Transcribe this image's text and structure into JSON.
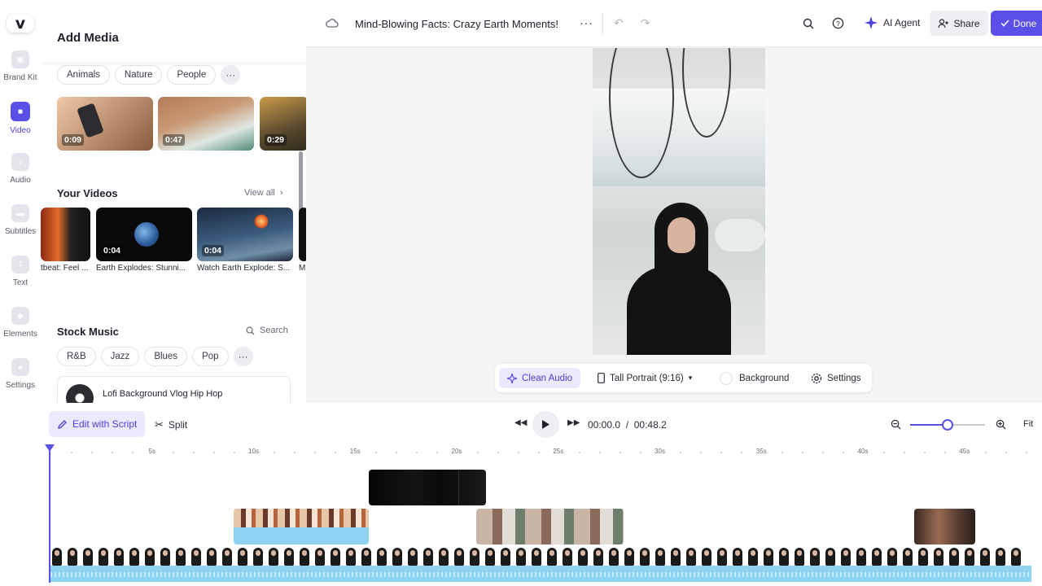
{
  "app": {
    "logo_letter": "v",
    "rail": [
      {
        "label": "Brand Kit",
        "icon": "brand-kit-icon",
        "active": false
      },
      {
        "label": "Video",
        "icon": "video-icon",
        "active": true
      },
      {
        "label": "Audio",
        "icon": "audio-icon",
        "active": false
      },
      {
        "label": "Subtitles",
        "icon": "subtitles-icon",
        "active": false
      },
      {
        "label": "Text",
        "icon": "text-icon",
        "active": false
      },
      {
        "label": "Elements",
        "icon": "elements-icon",
        "active": false
      },
      {
        "label": "Settings",
        "icon": "settings-icon",
        "active": false
      }
    ]
  },
  "panel": {
    "title": "Add Media",
    "video_chips": [
      "Animals",
      "Nature",
      "People"
    ],
    "stock_videos": [
      {
        "duration": "0:09",
        "colors": [
          "#f0c9a8",
          "#8a5a3c"
        ]
      },
      {
        "duration": "0:47",
        "colors": [
          "#b37b55",
          "#dfe8e3"
        ]
      },
      {
        "duration": "0:29",
        "colors": [
          "#5a4a2e",
          "#c99a4a"
        ]
      }
    ],
    "your_videos_title": "Your Videos",
    "view_all": "View all",
    "your_videos": [
      {
        "caption": "tbeat: Feel ...",
        "duration": ""
      },
      {
        "caption": "Earth Explodes: Stunni...",
        "duration": "0:04"
      },
      {
        "caption": "Watch Earth Explode: S...",
        "duration": "0:04"
      },
      {
        "caption": "Mi",
        "duration": ""
      }
    ],
    "stock_music_title": "Stock Music",
    "search_label": "Search",
    "music_chips": [
      "R&B",
      "Jazz",
      "Blues",
      "Pop"
    ],
    "music_track": "Lofi Background Vlog Hip Hop"
  },
  "topbar": {
    "project_title": "Mind-Blowing Facts: Crazy Earth Moments!",
    "ai_agent": "AI Agent",
    "share": "Share",
    "done": "Done",
    "accent": "#5a4fe6"
  },
  "preview_toolbar": {
    "clean_audio": "Clean Audio",
    "aspect": "Tall Portrait (9:16)",
    "background": "Background",
    "settings": "Settings"
  },
  "timeline": {
    "edit_with_script": "Edit with Script",
    "split": "Split",
    "current_time": "00:00.0",
    "separator": "/",
    "total_time": "00:48.2",
    "fit": "Fit",
    "zoom_level": 0.5,
    "ticks": [
      "5s",
      "10s",
      "15s",
      "20s",
      "25s",
      "30s",
      "35s",
      "40s",
      "45s"
    ]
  }
}
